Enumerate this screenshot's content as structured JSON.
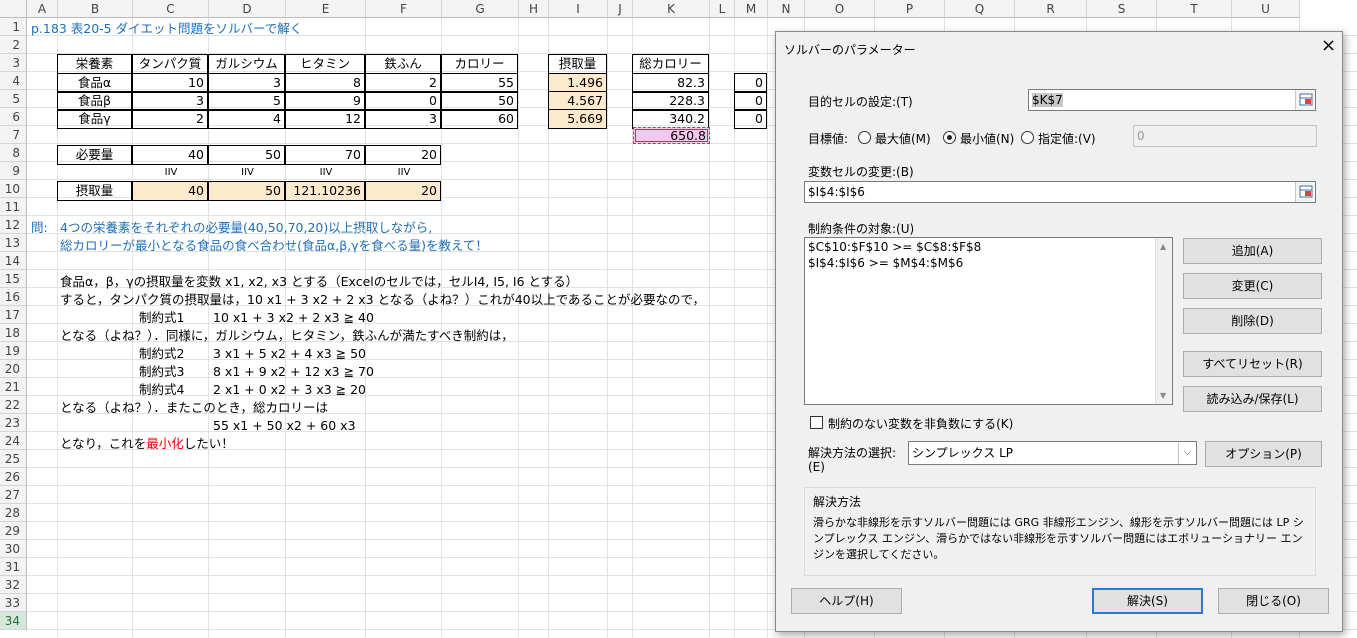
{
  "columns": [
    "A",
    "B",
    "C",
    "D",
    "E",
    "F",
    "G",
    "H",
    "I",
    "J",
    "K",
    "L",
    "M",
    "N",
    "O",
    "P",
    "Q",
    "R",
    "S",
    "T",
    "U"
  ],
  "rows": [
    "1",
    "2",
    "3",
    "4",
    "5",
    "6",
    "7",
    "8",
    "9",
    "10",
    "11",
    "12",
    "13",
    "14",
    "15",
    "16",
    "17",
    "18",
    "19",
    "20",
    "21",
    "22",
    "23",
    "24",
    "25",
    "26",
    "27",
    "28",
    "29",
    "30",
    "31",
    "32",
    "33",
    "34"
  ],
  "sheet": {
    "title": "p.183 表20-5 ダイエット問題をソルバーで解く",
    "header": {
      "nutrient": "栄養素",
      "protein": "タンパク質",
      "calcium": "ガルシウム",
      "vitamin": "ヒタミン",
      "iron": "鉄ふん",
      "calorie": "カロリー",
      "intake": "摂取量",
      "total": "総カロリー"
    },
    "foods": [
      {
        "name": "食品α",
        "protein": "10",
        "calcium": "3",
        "vitamin": "8",
        "iron": "2",
        "calorie": "55",
        "intake": "1.496",
        "total": "82.3",
        "m": "0"
      },
      {
        "name": "食品β",
        "protein": "3",
        "calcium": "5",
        "vitamin": "9",
        "iron": "0",
        "calorie": "50",
        "intake": "4.567",
        "total": "228.3",
        "m": "0"
      },
      {
        "name": "食品γ",
        "protein": "2",
        "calcium": "4",
        "vitamin": "12",
        "iron": "3",
        "calorie": "60",
        "intake": "5.669",
        "total": "340.2",
        "m": "0"
      }
    ],
    "total_calorie": "650.8",
    "required": {
      "label": "必要量",
      "values": [
        "40",
        "50",
        "70",
        "20"
      ]
    },
    "geq_symbol": "IIV",
    "intake_row": {
      "label": "摂取量",
      "values": [
        "40",
        "50",
        "121.10236",
        "20"
      ]
    },
    "question_prefix": "問:",
    "question_line1": "4つの栄養素をそれぞれの必要量(40,50,70,20)以上摂取しながら,",
    "question_line2": "総カロリーが最小となる食品の食べ合わせ(食品α,β,γを食べる量)を教えて！",
    "notes": [
      "食品α，β，γの摂取量を変数 x1, x2, x3 とする（Excelのセルでは，セルI4, I5, I6 とする）",
      "すると，タンパク質の摂取量は，10 x1 + 3 x2 + 2 x3 となる（よね？）これが40以上であることが必要なので，",
      "となる（よね？）．同様に，ガルシウム，ヒタミン，鉄ふんが満たすべき制約は，",
      "となる（よね？）．またこのとき，総カロリーは",
      "となり，これを"
    ],
    "red_word": "最小化",
    "tail": "したい！",
    "constraints": [
      {
        "label": "制約式1",
        "expr": "10 x1 + 3 x2 + 2 x3 ≧ 40"
      },
      {
        "label": "制約式2",
        "expr": "3 x1 + 5 x2 + 4 x3 ≧ 50"
      },
      {
        "label": "制約式3",
        "expr": "8 x1 + 9 x2 + 12 x3 ≧ 70"
      },
      {
        "label": "制約式4",
        "expr": "2 x1 + 0 x2 + 3 x3 ≧ 20"
      }
    ],
    "objective_expr": "55 x1 + 50 x2 + 60 x3"
  },
  "dialog": {
    "title": "ソルバーのパラメーター",
    "objective_label": "目的セルの設定:(T)",
    "objective_value": "$K$7",
    "goal_label": "目標値:",
    "max_label": "最大値(M)",
    "min_label": "最小値(N)",
    "value_label": "指定値:(V)",
    "value_field": "0",
    "selected_goal": "min",
    "vars_label": "変数セルの変更:(B)",
    "vars_value": "$I$4:$I$6",
    "constraints_label": "制約条件の対象:(U)",
    "constraints": [
      "$C$10:$F$10 >= $C$8:$F$8",
      "$I$4:$I$6 >= $M$4:$M$6"
    ],
    "add_button": "追加(A)",
    "change_button": "変更(C)",
    "delete_button": "削除(D)",
    "reset_button": "すべてリセット(R)",
    "load_save_button": "読み込み/保存(L)",
    "nonneg_label": "制約のない変数を非負数にする(K)",
    "nonneg_checked": false,
    "method_label_1": "解決方法の選択:",
    "method_label_2": "(E)",
    "method_value": "シンプレックス LP",
    "options_button": "オプション(P)",
    "method_group_title": "解決方法",
    "method_desc": "滑らかな非線形を示すソルバー問題には GRG 非線形エンジン、線形を示すソルバー問題には LP シンプレックス エンジン、滑らかではない非線形を示すソルバー問題にはエボリューショナリー エンジンを選択してください。",
    "help_button": "ヘルプ(H)",
    "solve_button": "解決(S)",
    "close_button": "閉じる(O)",
    "close_icon": "×"
  }
}
